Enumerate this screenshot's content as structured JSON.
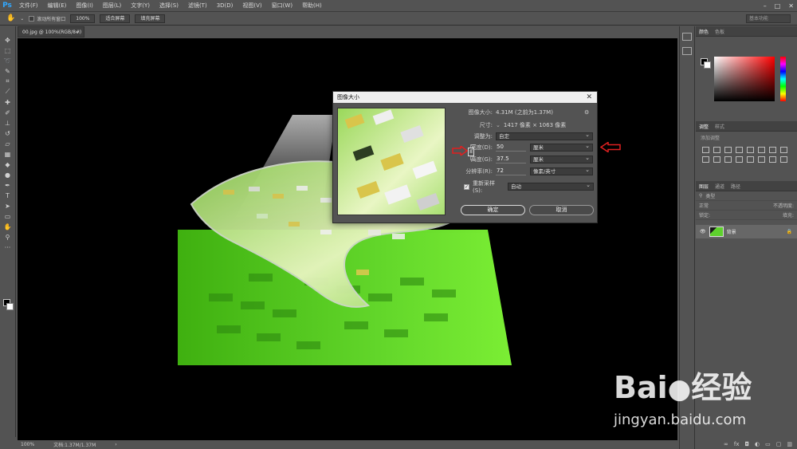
{
  "app": {
    "logo": "Ps",
    "menu": [
      "文件(F)",
      "编辑(E)",
      "图像(I)",
      "图层(L)",
      "文字(Y)",
      "选择(S)",
      "滤镜(T)",
      "3D(D)",
      "视图(V)",
      "窗口(W)",
      "帮助(H)"
    ],
    "window_controls": [
      "–",
      "□",
      "✕"
    ]
  },
  "options_bar": {
    "scroll_all_label": "滚动所有窗口",
    "zoom_btn": "100%",
    "fit_screen_btn": "适合屏幕",
    "fill_screen_btn": "填充屏幕",
    "workspace": "基本功能"
  },
  "document": {
    "tab_title": "00.jpg @ 100%(RGB/8#)",
    "tab_close": "×"
  },
  "status": {
    "zoom": "100%",
    "doc_info": "文档:1.37M/1.37M",
    "arrow": "›"
  },
  "dialog": {
    "title": "图像大小",
    "close": "✕",
    "image_size_label": "图像大小:",
    "image_size_value": "4.31M (之前为1.37M)",
    "dimensions_label": "尺寸:",
    "dimensions_value": "1417 像素 × 1063 像素",
    "fit_to_label": "调整为:",
    "fit_to_value": "自定",
    "width_label": "宽度(D):",
    "width_value": "50",
    "width_unit": "厘米",
    "height_label": "高度(G):",
    "height_value": "37.5",
    "height_unit": "厘米",
    "resolution_label": "分辨率(R):",
    "resolution_value": "72",
    "resolution_unit": "像素/英寸",
    "resample_label": "重新采样(S):",
    "resample_value": "自动",
    "ok": "确定",
    "cancel": "取消"
  },
  "panels": {
    "color_tabs": [
      "颜色",
      "色板"
    ],
    "adjust_tabs": [
      "调整",
      "样式"
    ],
    "add_adjustment": "添加调整",
    "layers_tabs": [
      "图层",
      "通道",
      "路径"
    ],
    "kind_filter": "类型",
    "blend_mode": "正常",
    "opacity_label": "不透明度:",
    "lock_label": "锁定:",
    "fill_label": "填充:",
    "layer_name": "背景"
  },
  "watermark": {
    "brand": "Bai",
    "brand_suffix": "经验",
    "url": "jingyan.baidu.com"
  },
  "colors": {
    "accent": "#31a8ff",
    "red_arrow": "#e02020",
    "green_floor": "#5ed12d"
  }
}
